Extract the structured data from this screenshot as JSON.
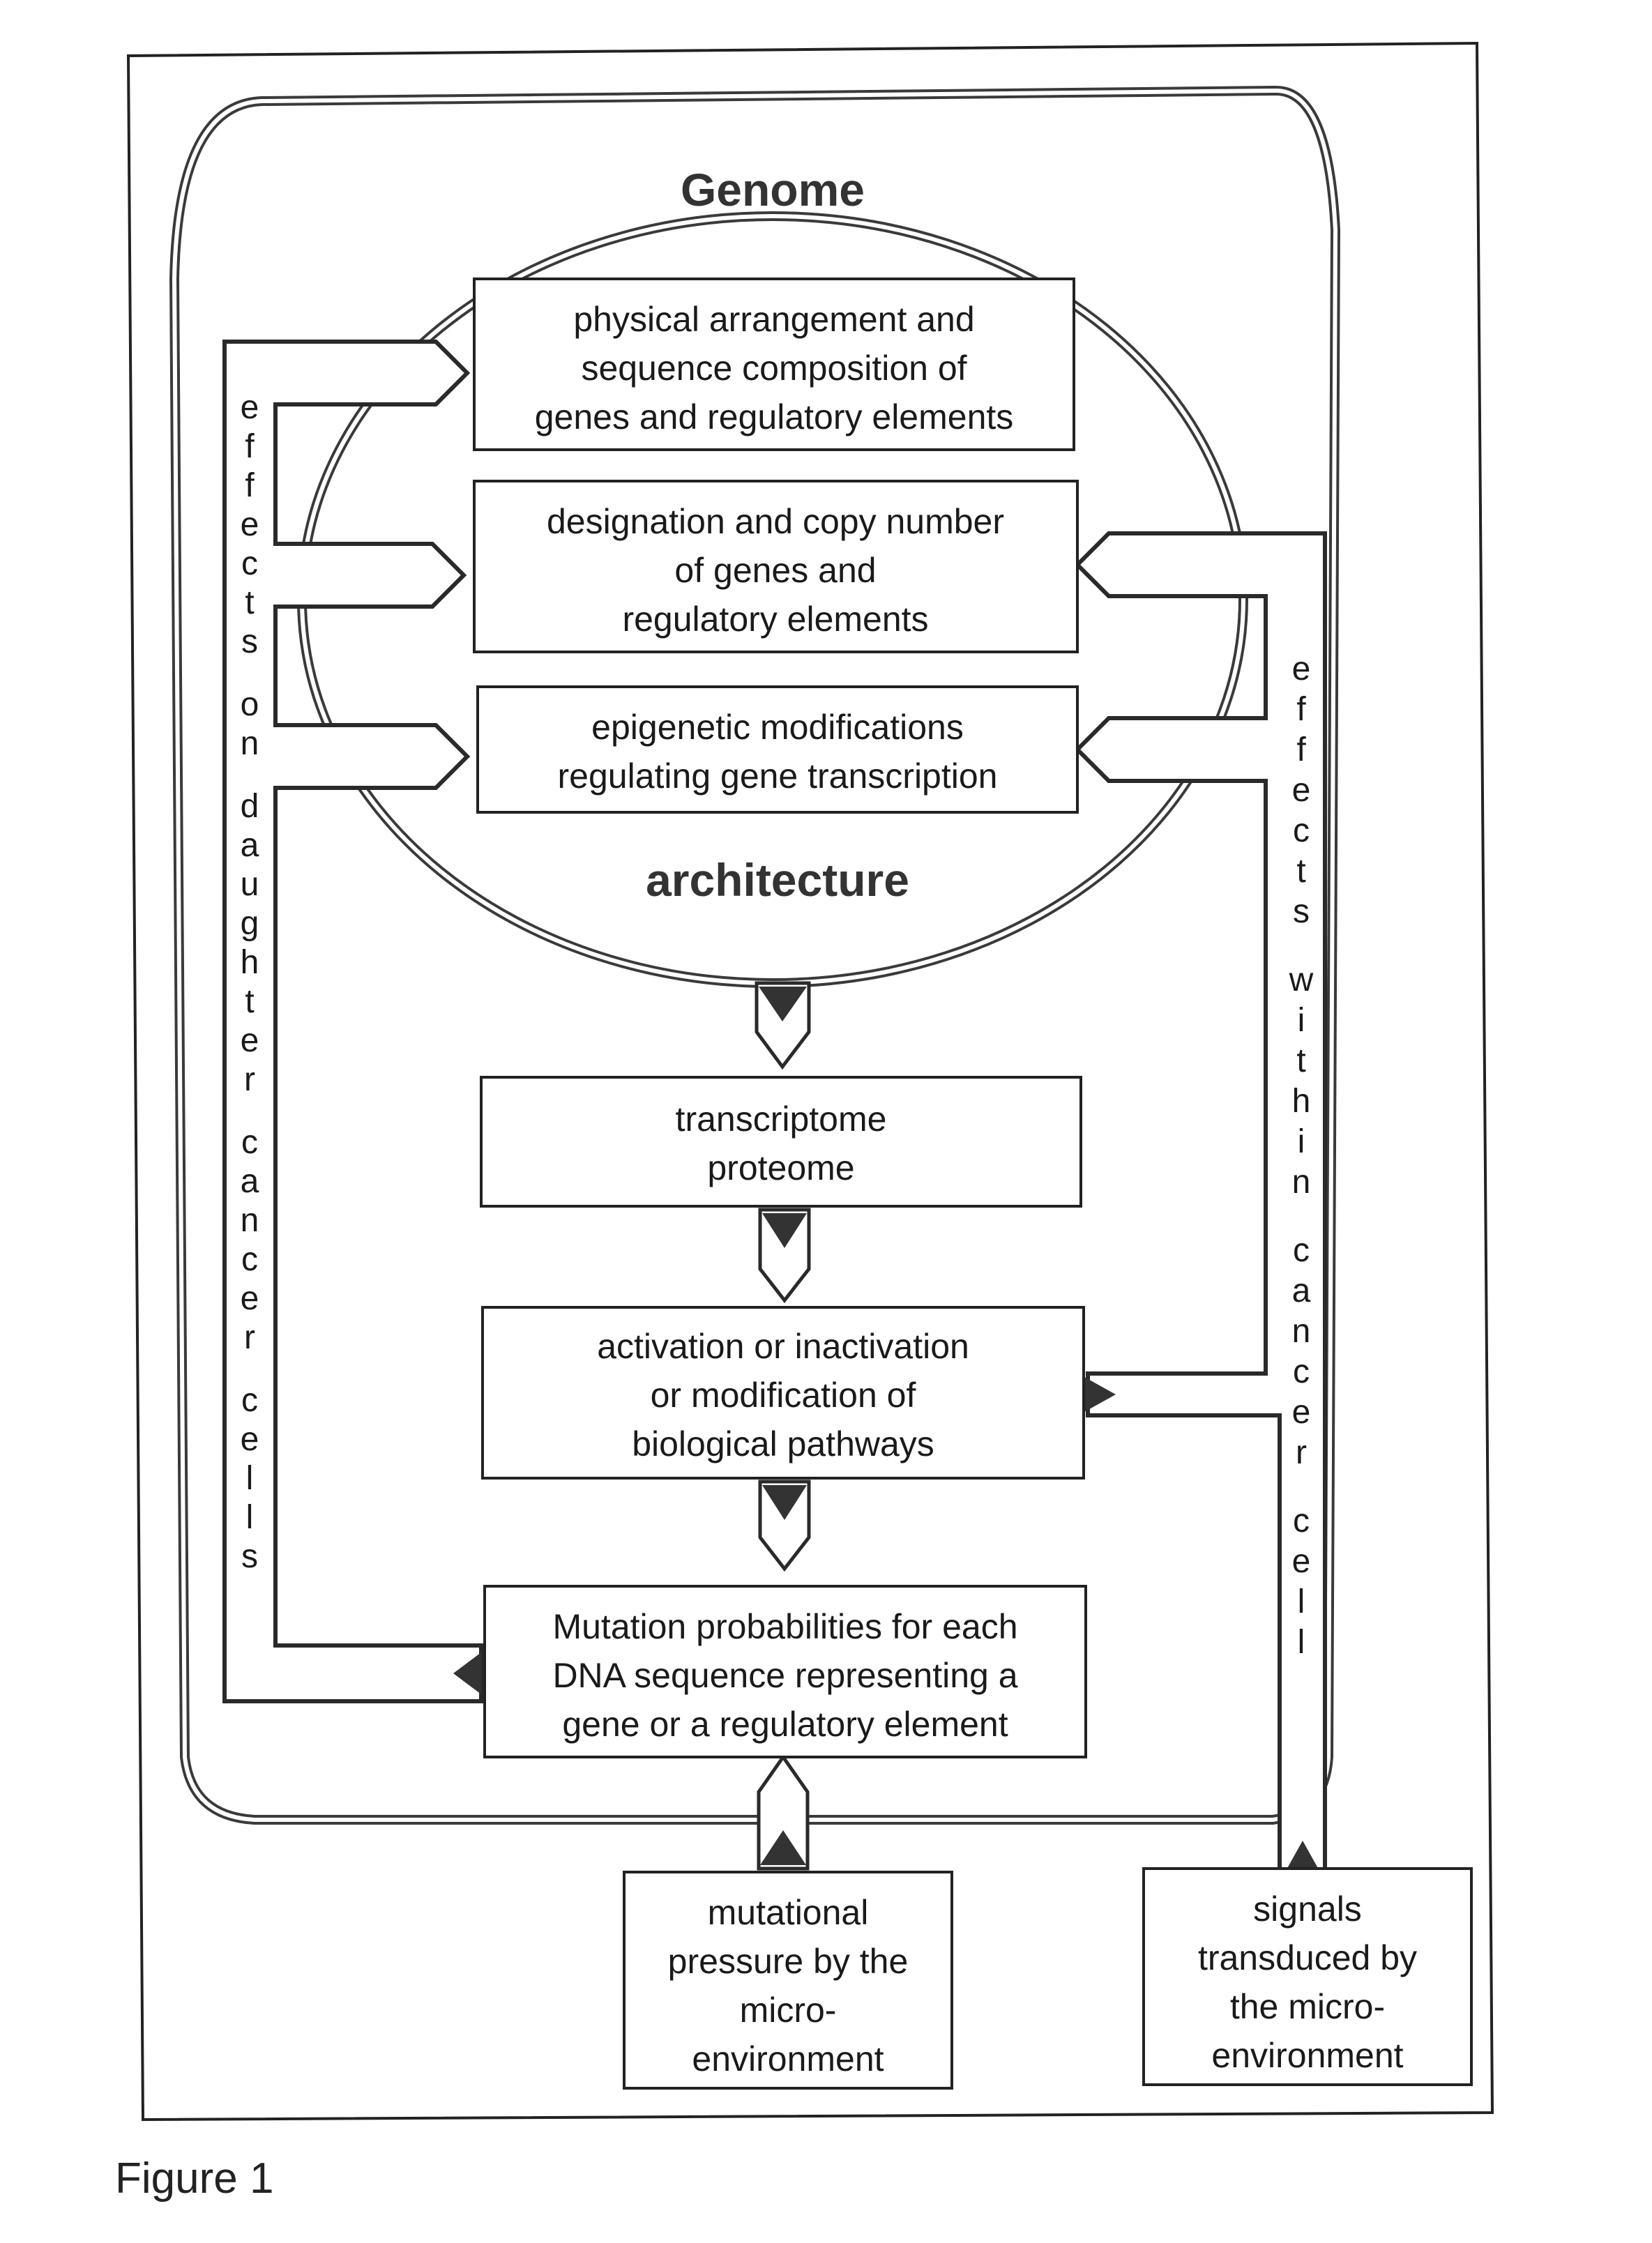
{
  "figure": {
    "caption": "Figure 1",
    "genome_title": "Genome",
    "architecture_title": "architecture",
    "genome_boxes": [
      {
        "lines": [
          "physical arrangement and",
          "sequence composition of",
          "genes and regulatory elements"
        ]
      },
      {
        "lines": [
          "designation and copy number",
          "of genes and",
          "regulatory elements"
        ]
      },
      {
        "lines": [
          "epigenetic modifications",
          "regulating gene transcription"
        ]
      }
    ],
    "flow_boxes": [
      {
        "lines": [
          "transcriptome",
          "proteome"
        ]
      },
      {
        "lines": [
          "activation or inactivation",
          "or modification of",
          "biological pathways"
        ]
      },
      {
        "lines": [
          "Mutation probabilities for each",
          "DNA sequence representing a",
          "gene or a regulatory element"
        ]
      }
    ],
    "input_boxes": [
      {
        "lines": [
          "mutational",
          "pressure by the",
          "micro-",
          "environment"
        ]
      },
      {
        "lines": [
          "signals",
          "transduced by",
          "the micro-",
          "environment"
        ]
      }
    ],
    "left_loop_label": "effects on daughter cancer cells",
    "right_loop_label": "effects within cancer cell"
  }
}
